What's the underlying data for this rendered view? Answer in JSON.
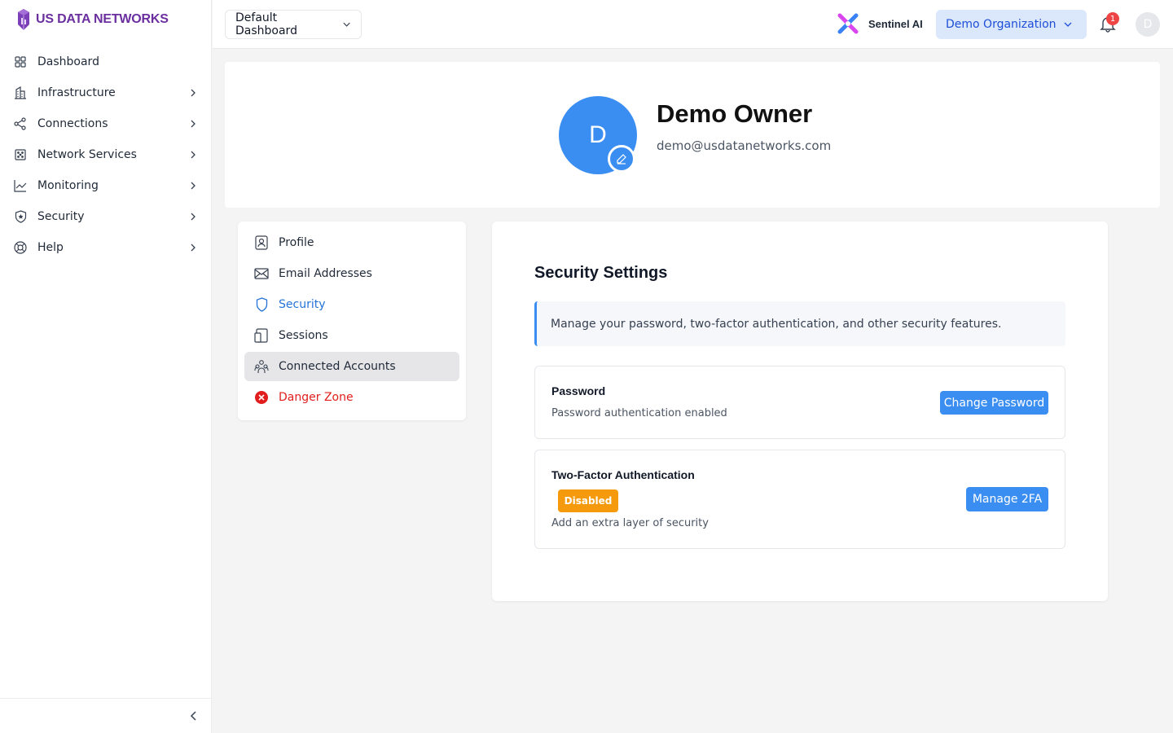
{
  "brand": {
    "name": "US DATA NETWORKS",
    "color": "#6b2fa0"
  },
  "sidebar": {
    "items": [
      {
        "label": "Dashboard",
        "icon": "grid-icon",
        "has_children": false
      },
      {
        "label": "Infrastructure",
        "icon": "building-icon",
        "has_children": true
      },
      {
        "label": "Connections",
        "icon": "share-icon",
        "has_children": true
      },
      {
        "label": "Network Services",
        "icon": "network-icon",
        "has_children": true
      },
      {
        "label": "Monitoring",
        "icon": "chart-line-icon",
        "has_children": true
      },
      {
        "label": "Security",
        "icon": "shield-icon",
        "has_children": true
      },
      {
        "label": "Help",
        "icon": "lifebuoy-icon",
        "has_children": true
      }
    ]
  },
  "header": {
    "dashboard_select": "Default Dashboard",
    "sentinel_label": "Sentinel AI",
    "organization": "Demo Organization",
    "notification_count": "1",
    "user_initial": "D"
  },
  "profile": {
    "initial": "D",
    "name": "Demo Owner",
    "email": "demo@usdatanetworks.com"
  },
  "settings_menu": {
    "items": [
      {
        "label": "Profile",
        "icon": "profile-icon",
        "state": "normal"
      },
      {
        "label": "Email Addresses",
        "icon": "envelope-icon",
        "state": "normal"
      },
      {
        "label": "Security",
        "icon": "shield-icon",
        "state": "active"
      },
      {
        "label": "Sessions",
        "icon": "devices-icon",
        "state": "normal"
      },
      {
        "label": "Connected Accounts",
        "icon": "users-icon",
        "state": "hover"
      },
      {
        "label": "Danger Zone",
        "icon": "x-circle-icon",
        "state": "danger"
      }
    ]
  },
  "security": {
    "title": "Security Settings",
    "info": "Manage your password, two-factor authentication, and other security features.",
    "password": {
      "title": "Password",
      "subtitle": "Password authentication enabled",
      "button": "Change Password"
    },
    "two_factor": {
      "title": "Two-Factor Authentication",
      "status": "Disabled",
      "subtitle": "Add an extra layer of security",
      "button": "Manage 2FA"
    }
  },
  "colors": {
    "accent": "#3b8ef1",
    "active_link": "#2573d8",
    "danger": "#e11d1d",
    "warning": "#f59a0c",
    "org_bg": "#dbe7fb"
  }
}
